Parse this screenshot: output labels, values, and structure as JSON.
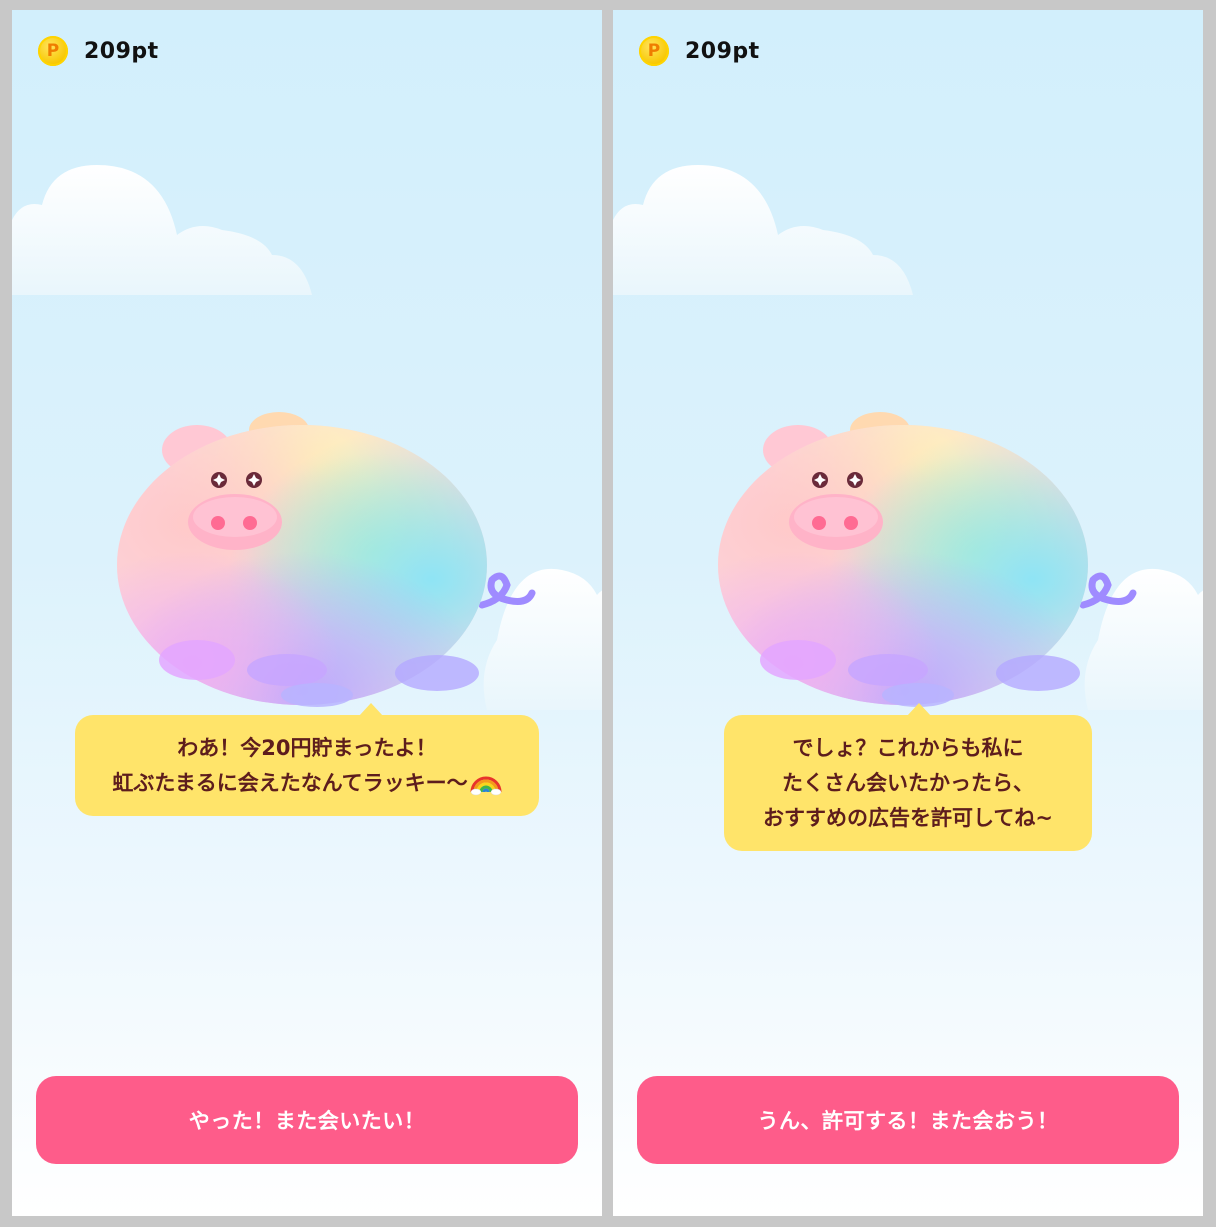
{
  "screens": [
    {
      "points": {
        "coin_label": "P",
        "value": "209pt"
      },
      "speech": {
        "lines": [
          "わあ！今20円貯まったよ！",
          "虹ぶたまるに会えたなんてラッキー～"
        ],
        "emoji": "rainbow-icon"
      },
      "cta_label": "やった！また会いたい！"
    },
    {
      "points": {
        "coin_label": "P",
        "value": "209pt"
      },
      "speech": {
        "lines": [
          "でしょ？これからも私に",
          "たくさん会いたかったら、",
          "おすすめの広告を許可してね~"
        ]
      },
      "cta_label": "うん、許可する！また会おう！"
    }
  ],
  "colors": {
    "sky_top": "#d2effc",
    "bubble": "#ffe46a",
    "bubble_text": "#5d1d1d",
    "cta": "#fe5c8a",
    "coin": "#f7c600"
  }
}
